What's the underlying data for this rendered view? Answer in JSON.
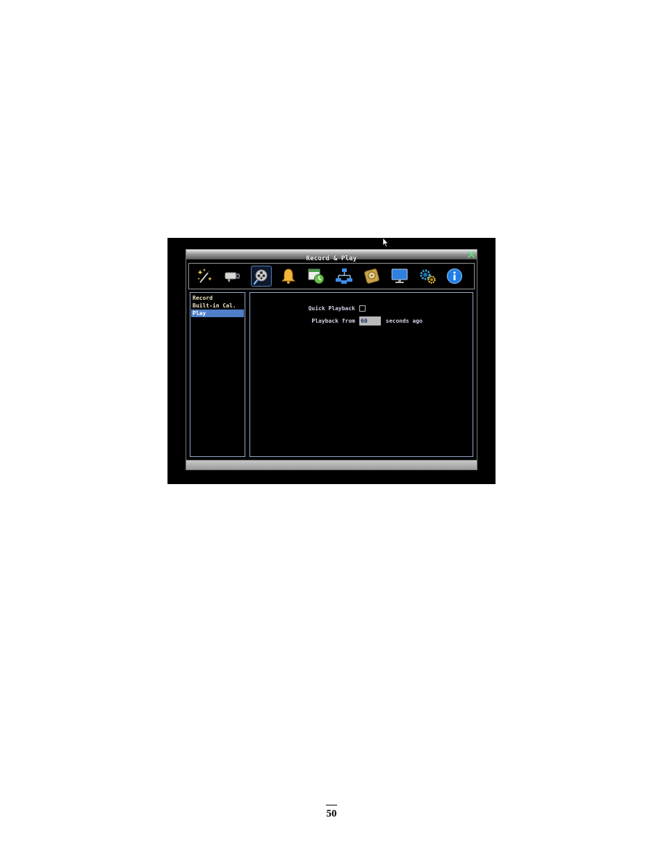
{
  "window": {
    "title": "Record & Play"
  },
  "toolbar": {
    "items": [
      {
        "icon": "magic-wand-icon"
      },
      {
        "icon": "camera-icon"
      },
      {
        "icon": "film-reel-magnifier-icon",
        "active": true
      },
      {
        "icon": "bell-icon"
      },
      {
        "icon": "calendar-clock-icon"
      },
      {
        "icon": "network-icon"
      },
      {
        "icon": "hard-disk-icon"
      },
      {
        "icon": "monitor-icon"
      },
      {
        "icon": "gears-icon"
      },
      {
        "icon": "info-icon"
      }
    ]
  },
  "sidebar": {
    "items": [
      {
        "label": "Record"
      },
      {
        "label": "Built-in Cal."
      },
      {
        "label": "Play",
        "selected": true
      }
    ]
  },
  "content": {
    "quick_playback_label": "Quick Playback",
    "quick_playback_checked": false,
    "playback_from_label": "Playback from",
    "playback_from_value": "60",
    "seconds_ago_label": "seconds ago"
  },
  "page": {
    "number": "50"
  },
  "colors": {
    "accent": "#4f7fc9",
    "background": "#000000"
  }
}
